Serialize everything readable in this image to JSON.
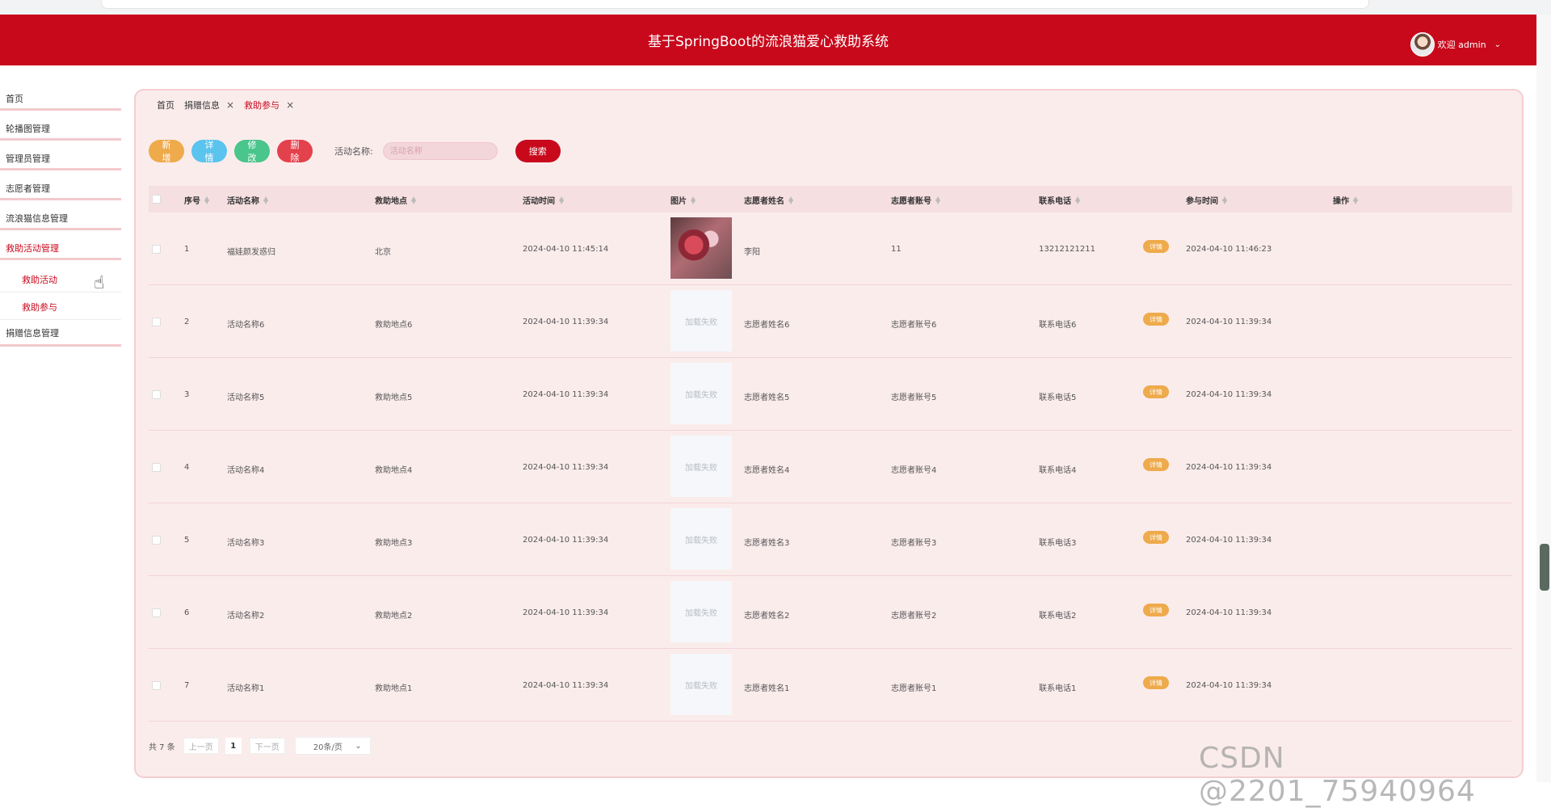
{
  "header": {
    "title": "基于SpringBoot的流浪猫爱心救助系统",
    "user": "欢迎 admin"
  },
  "sidebar": {
    "items": [
      {
        "label": "首页"
      },
      {
        "label": "轮播图管理"
      },
      {
        "label": "管理员管理"
      },
      {
        "label": "志愿者管理"
      },
      {
        "label": "流浪猫信息管理"
      },
      {
        "label": "救助活动管理"
      }
    ],
    "sub_items": [
      {
        "label": "救助活动"
      },
      {
        "label": "救助参与"
      }
    ],
    "last_item": {
      "label": "捐赠信息管理"
    }
  },
  "tabs": [
    {
      "label": "首页"
    },
    {
      "label": "捐赠信息"
    },
    {
      "label": "救助参与"
    }
  ],
  "toolbar": {
    "add": "新增",
    "detail": "详情",
    "edit": "修改",
    "delete": "删除",
    "search_label": "活动名称:",
    "search_placeholder": "活动名称",
    "search_button": "搜索"
  },
  "table": {
    "headers": [
      "序号",
      "活动名称",
      "救助地点",
      "活动时间",
      "图片",
      "志愿者姓名",
      "志愿者账号",
      "联系电话",
      "参与时间",
      "操作"
    ],
    "img_fail": "加载失败",
    "action_label": "详情",
    "rows": [
      {
        "no": "1",
        "name": "福娃颜发惑归",
        "place": "北京",
        "time": "2024-04-10 11:45:14",
        "vol_name": "李阳",
        "vol_account": "11",
        "phone": "13212121211",
        "join_time": "2024-04-10 11:46:23"
      },
      {
        "no": "2",
        "name": "活动名称6",
        "place": "救助地点6",
        "time": "2024-04-10 11:39:34",
        "vol_name": "志愿者姓名6",
        "vol_account": "志愿者账号6",
        "phone": "联系电话6",
        "join_time": "2024-04-10 11:39:34"
      },
      {
        "no": "3",
        "name": "活动名称5",
        "place": "救助地点5",
        "time": "2024-04-10 11:39:34",
        "vol_name": "志愿者姓名5",
        "vol_account": "志愿者账号5",
        "phone": "联系电话5",
        "join_time": "2024-04-10 11:39:34"
      },
      {
        "no": "4",
        "name": "活动名称4",
        "place": "救助地点4",
        "time": "2024-04-10 11:39:34",
        "vol_name": "志愿者姓名4",
        "vol_account": "志愿者账号4",
        "phone": "联系电话4",
        "join_time": "2024-04-10 11:39:34"
      },
      {
        "no": "5",
        "name": "活动名称3",
        "place": "救助地点3",
        "time": "2024-04-10 11:39:34",
        "vol_name": "志愿者姓名3",
        "vol_account": "志愿者账号3",
        "phone": "联系电话3",
        "join_time": "2024-04-10 11:39:34"
      },
      {
        "no": "6",
        "name": "活动名称2",
        "place": "救助地点2",
        "time": "2024-04-10 11:39:34",
        "vol_name": "志愿者姓名2",
        "vol_account": "志愿者账号2",
        "phone": "联系电话2",
        "join_time": "2024-04-10 11:39:34"
      },
      {
        "no": "7",
        "name": "活动名称1",
        "place": "救助地点1",
        "time": "2024-04-10 11:39:34",
        "vol_name": "志愿者姓名1",
        "vol_account": "志愿者账号1",
        "phone": "联系电话1",
        "join_time": "2024-04-10 11:39:34"
      }
    ]
  },
  "pager": {
    "total": "共 7 条",
    "prev": "上一页",
    "page": "1",
    "next": "下一页",
    "size": "20条/页"
  },
  "watermark": "CSDN @2201_75940964",
  "colors": {
    "brand": "#c8091c",
    "panel": "#fbecec",
    "add": "#eeaa4b",
    "detail": "#5bc4ee",
    "edit": "#4ac58b",
    "delete": "#e3414c"
  }
}
